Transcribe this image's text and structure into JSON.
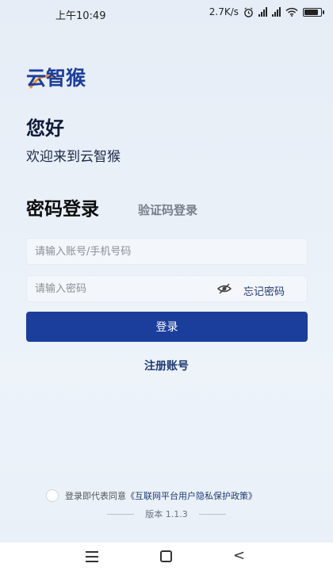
{
  "status_bar": {
    "time": "上午10:49",
    "speed": "2.7K/s",
    "signal1_label": "4G",
    "signal2_label": "4G",
    "battery_level": 0.9
  },
  "logo": {
    "text": "云智猴"
  },
  "greeting": "您好",
  "welcome": "欢迎来到云智猴",
  "tabs": {
    "password_login": "密码登录",
    "code_login": "验证码登录"
  },
  "form": {
    "account_placeholder": "请输入账号/手机号码",
    "password_placeholder": "请输入密码",
    "forgot_password": "忘记密码",
    "login_button": "登录",
    "register": "注册账号"
  },
  "agreement": {
    "prefix": "登录即代表同意",
    "policy": "《互联网平台用户隐私保护政策》"
  },
  "version": "版本 1.1.3",
  "colors": {
    "primary": "#1b3e9c",
    "link": "#1f3a74",
    "logo_orange": "#f08a24"
  }
}
